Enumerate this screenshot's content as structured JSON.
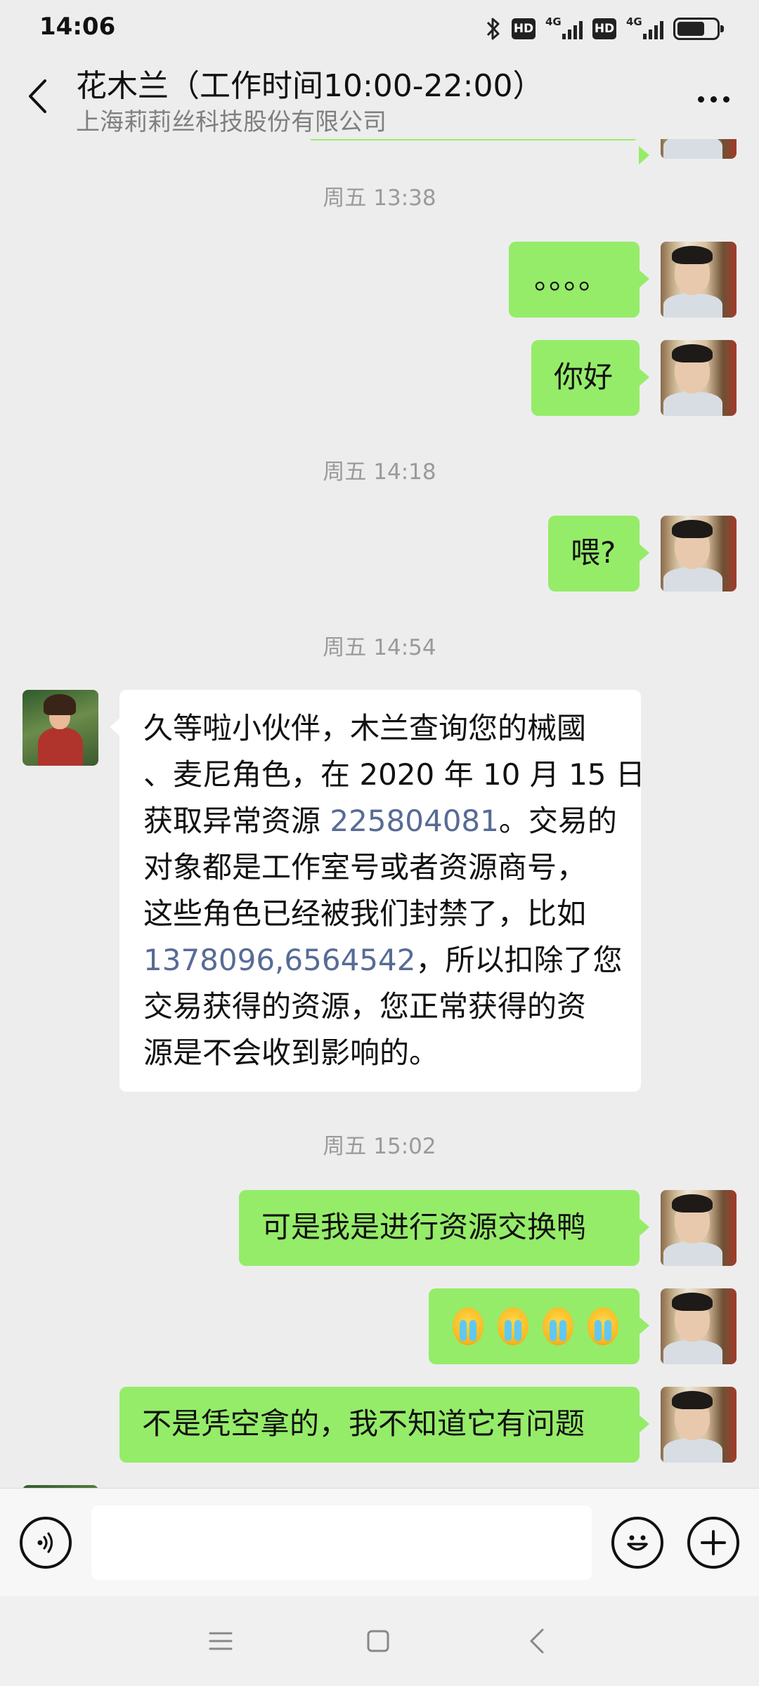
{
  "status_bar": {
    "time": "14:06",
    "hd1": "HD",
    "hd2": "HD",
    "net1": "4G",
    "net2": "4G",
    "battery_level": 0.7
  },
  "header": {
    "title": "花木兰（工作时间10:00-22:00）",
    "subtitle": "上海莉莉丝科技股份有限公司"
  },
  "messages": {
    "ts1": "周五 13:38",
    "m1": "。。。。",
    "m2": "你好",
    "ts2": "周五 14:18",
    "m3": "喂?",
    "ts3": "周五 14:54",
    "reply": {
      "line1": "久等啦小伙伴，木兰查询您的械國",
      "line2": "、麦尼角色，在 2020 年 10 月 15 日",
      "line3_prefix": "获取异常资源 ",
      "line3_link": "225804081",
      "line3_suffix": "。交易的",
      "line4": "对象都是工作室号或者资源商号，",
      "line5": "这些角色已经被我们封禁了，比如",
      "line6_link": "1378096,6564542",
      "line6_suffix": "，所以扣除了您",
      "line7": "交易获得的资源，您正常获得的资",
      "line8": "源是不会收到影响的。"
    },
    "ts4": "周五 15:02",
    "m4": "可是我是进行资源交换鸭",
    "m5_emoji": "crying-face x4",
    "m6": "不是凭空拿的，我不知道它有问题"
  },
  "input_bar": {
    "placeholder": ""
  },
  "colors": {
    "background": "#ededed",
    "my_bubble": "#95ec69",
    "their_bubble": "#ffffff",
    "link": "#576b95"
  }
}
